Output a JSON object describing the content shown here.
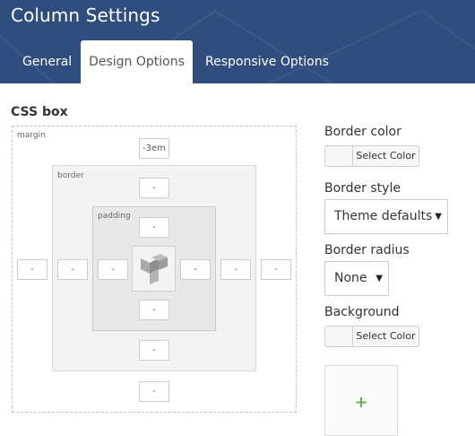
{
  "header": {
    "title": "Column Settings",
    "tabs": [
      {
        "label": "General",
        "active": false
      },
      {
        "label": "Design Options",
        "active": true
      },
      {
        "label": "Responsive Options",
        "active": false
      }
    ]
  },
  "css_box": {
    "title": "CSS box",
    "margin_label": "margin",
    "border_label": "border",
    "padding_label": "padding",
    "margin": {
      "top": "-3em",
      "right": "-",
      "bottom": "-",
      "left": "-"
    },
    "border": {
      "top": "-",
      "right": "-",
      "bottom": "-",
      "left": "-"
    },
    "padding": {
      "top": "-",
      "right": "-",
      "bottom": "-",
      "left": "-"
    }
  },
  "border_color": {
    "label": "Border color",
    "button": "Select Color"
  },
  "border_style": {
    "label": "Border style",
    "value": "Theme defaults"
  },
  "border_radius": {
    "label": "Border radius",
    "value": "None"
  },
  "background": {
    "label": "Background",
    "button": "Select Color",
    "add_symbol": "+"
  },
  "colors": {
    "header_bg": "#2f4e7e",
    "accent_green": "#6ab04c"
  },
  "icons": {
    "logo": "vc-logo-icon",
    "add": "plus-icon",
    "dropdown": "caret-down-icon"
  }
}
